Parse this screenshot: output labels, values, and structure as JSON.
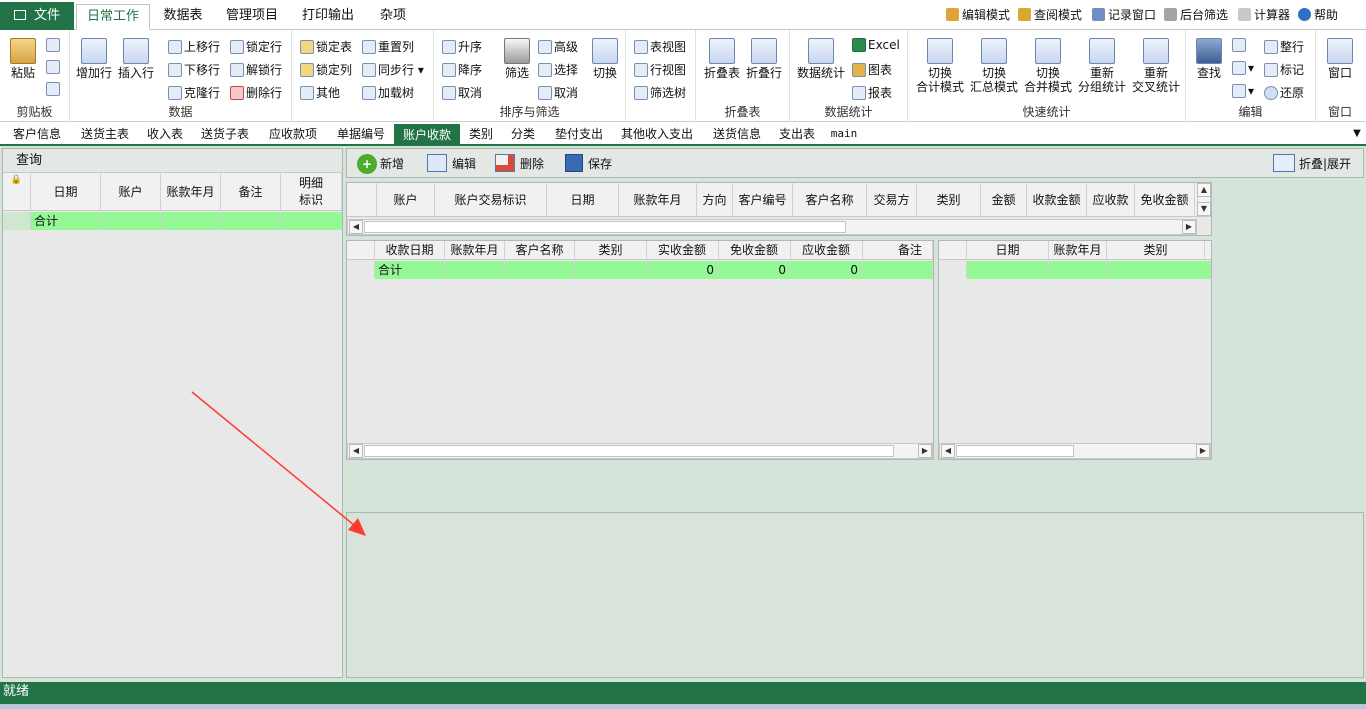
{
  "menu": {
    "file": "文件",
    "tabs": [
      "日常工作",
      "数据表",
      "管理项目",
      "打印输出",
      "杂项"
    ],
    "right_tools": [
      "编辑模式",
      "查阅模式",
      "记录窗口",
      "后台筛选",
      "计算器",
      "帮助"
    ]
  },
  "ribbon": {
    "clipboard": {
      "label": "剪贴板",
      "paste": "粘贴"
    },
    "data": {
      "label": "数据",
      "add_row": "增加行",
      "insert_row": "插入行",
      "move_up": "上移行",
      "move_down": "下移行",
      "clone_row": "克隆行",
      "lock_row": "锁定行",
      "unlock_row": "解锁行",
      "delete_row": "删除行"
    },
    "table": {
      "lock_table": "锁定表",
      "lock_col": "锁定列",
      "other": "其他",
      "reset_col": "重置列",
      "sync_row": "同步行",
      "load_tree": "加载树"
    },
    "sort": {
      "label": "排序与筛选",
      "asc": "升序",
      "desc": "降序",
      "cancel": "取消",
      "filter": "筛选",
      "advanced": "高级",
      "select": "选择",
      "cancel2": "取消",
      "switch": "切换"
    },
    "view": {
      "table_view": "表视图",
      "row_view": "行视图",
      "filter_tree": "筛选树"
    },
    "fold": {
      "label": "折叠表",
      "fold_table": "折叠表",
      "fold_row": "折叠行"
    },
    "stats": {
      "label": "数据统计",
      "data_stats": "数据统计",
      "excel": "Excel",
      "chart": "图表",
      "report": "报表"
    },
    "quick": {
      "label": "快速统计",
      "b1": "切换\n合计模式",
      "b2": "切换\n汇总模式",
      "b3": "切换\n合并模式",
      "b4": "重新\n分组统计",
      "b5": "重新\n交叉统计"
    },
    "edit": {
      "label": "编辑",
      "find": "查找",
      "tidy": "整行",
      "mark": "标记",
      "restore": "还原"
    },
    "window": {
      "label": "窗口",
      "window": "窗口"
    }
  },
  "sheet_tabs": [
    "客户信息",
    "送货主表",
    "收入表",
    "送货子表",
    "应收款项",
    "单据编号",
    "账户收款",
    "类别",
    "分类",
    "垫付支出",
    "其他收入支出",
    "送货信息",
    "支出表",
    "main"
  ],
  "active_sheet": "账户收款",
  "query_panel": {
    "title": "查询",
    "columns": [
      "日期",
      "账户",
      "账款年月",
      "备注",
      "明细标识"
    ],
    "total_label": "合计"
  },
  "toolbar": {
    "new": "新增",
    "edit": "编辑",
    "delete": "删除",
    "save": "保存",
    "fold_expand": "折叠|展开"
  },
  "main_grid": {
    "columns": [
      "账户",
      "账户交易标识",
      "日期",
      "账款年月",
      "方向",
      "客户编号",
      "客户名称",
      "交易方",
      "类别",
      "金额",
      "收款金额",
      "应收款",
      "免收金额"
    ]
  },
  "sub_grid_left": {
    "columns": [
      "收款日期",
      "账款年月",
      "客户名称",
      "类别",
      "实收金额",
      "免收金额",
      "应收金额",
      "备注"
    ],
    "total_label": "合计",
    "totals": [
      "0",
      "0",
      "0"
    ]
  },
  "sub_grid_right": {
    "columns": [
      "日期",
      "账款年月",
      "类别"
    ]
  },
  "status": "就绪",
  "colors": {
    "accent": "#227447",
    "total_row": "#94f894",
    "arrow": "#ff3b2f"
  }
}
